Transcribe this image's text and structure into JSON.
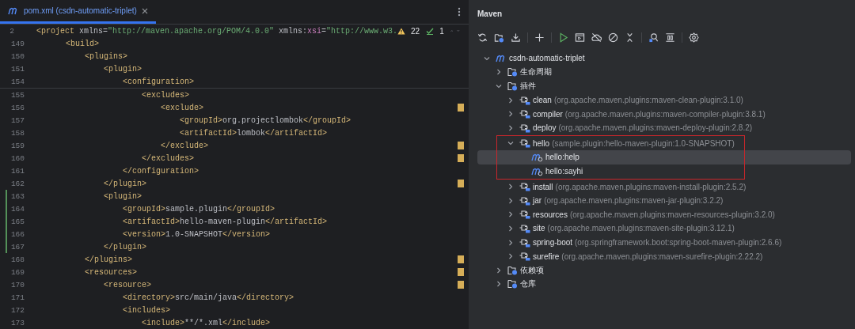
{
  "editor": {
    "tab": {
      "label": "pom.xml (csdn-automatic-triplet)",
      "selected": true
    },
    "inspections": {
      "warnings": "22",
      "checks": "1"
    },
    "sticky_lines": [
      {
        "number": "2",
        "segments": [
          {
            "kind": "tag",
            "text": "<project"
          },
          {
            "kind": "attr",
            "text": " xmlns="
          },
          {
            "kind": "value",
            "text": "\"http://maven.apache.org/POM/4.0.0\""
          },
          {
            "kind": "attr",
            "text": " xmlns:"
          },
          {
            "kind": "ns",
            "text": "xsi"
          },
          {
            "kind": "attr",
            "text": "="
          },
          {
            "kind": "value",
            "text": "\"http://www.w3."
          }
        ]
      },
      {
        "number": "149",
        "segments": [
          {
            "kind": "tag",
            "text": "    <build>"
          }
        ]
      },
      {
        "number": "150",
        "segments": [
          {
            "kind": "tag",
            "text": "        <plugins>"
          }
        ]
      },
      {
        "number": "151",
        "segments": [
          {
            "kind": "tag",
            "text": "            <plugin>"
          }
        ]
      },
      {
        "number": "154",
        "segments": [
          {
            "kind": "tag",
            "text": "                <configuration>"
          }
        ]
      }
    ],
    "lines": [
      {
        "number": "155",
        "changed": false,
        "marker": false,
        "segments": [
          {
            "kind": "tag",
            "text": "                    <excludes>"
          }
        ]
      },
      {
        "number": "156",
        "changed": false,
        "marker": true,
        "segments": [
          {
            "kind": "tag",
            "text": "                        <exclude>"
          }
        ]
      },
      {
        "number": "157",
        "changed": false,
        "marker": false,
        "segments": [
          {
            "kind": "tag",
            "text": "                            <groupId>"
          },
          {
            "kind": "text",
            "text": "org.projectlombok"
          },
          {
            "kind": "tag",
            "text": "</groupId>"
          }
        ]
      },
      {
        "number": "158",
        "changed": false,
        "marker": false,
        "segments": [
          {
            "kind": "tag",
            "text": "                            <artifactId>"
          },
          {
            "kind": "text",
            "text": "lombok"
          },
          {
            "kind": "tag",
            "text": "</artifactId>"
          }
        ]
      },
      {
        "number": "159",
        "changed": false,
        "marker": true,
        "segments": [
          {
            "kind": "tag",
            "text": "                        </exclude>"
          }
        ]
      },
      {
        "number": "160",
        "changed": false,
        "marker": true,
        "segments": [
          {
            "kind": "tag",
            "text": "                    </excludes>"
          }
        ]
      },
      {
        "number": "161",
        "changed": false,
        "marker": false,
        "segments": [
          {
            "kind": "tag",
            "text": "                </configuration>"
          }
        ]
      },
      {
        "number": "162",
        "changed": false,
        "marker": true,
        "segments": [
          {
            "kind": "tag",
            "text": "            </plugin>"
          }
        ]
      },
      {
        "number": "163",
        "changed": true,
        "marker": false,
        "segments": [
          {
            "kind": "tag",
            "text": "            <plugin>"
          }
        ]
      },
      {
        "number": "164",
        "changed": true,
        "marker": false,
        "segments": [
          {
            "kind": "tag",
            "text": "                <groupId>"
          },
          {
            "kind": "text",
            "text": "sample.plugin"
          },
          {
            "kind": "tag",
            "text": "</groupId>"
          }
        ]
      },
      {
        "number": "165",
        "changed": true,
        "marker": false,
        "segments": [
          {
            "kind": "tag",
            "text": "                <artifactId>"
          },
          {
            "kind": "text",
            "text": "hello-maven-plugin"
          },
          {
            "kind": "tag",
            "text": "</artifactId>"
          }
        ]
      },
      {
        "number": "166",
        "changed": true,
        "marker": false,
        "segments": [
          {
            "kind": "tag",
            "text": "                <version>"
          },
          {
            "kind": "text",
            "text": "1.0-SNAPSHOT"
          },
          {
            "kind": "tag",
            "text": "</version>"
          }
        ]
      },
      {
        "number": "167",
        "changed": true,
        "marker": false,
        "segments": [
          {
            "kind": "tag",
            "text": "            </plugin>"
          }
        ]
      },
      {
        "number": "168",
        "changed": false,
        "marker": true,
        "segments": [
          {
            "kind": "tag",
            "text": "        </plugins>"
          }
        ]
      },
      {
        "number": "169",
        "changed": false,
        "marker": true,
        "segments": [
          {
            "kind": "tag",
            "text": "        <resources>"
          }
        ]
      },
      {
        "number": "170",
        "changed": false,
        "marker": true,
        "segments": [
          {
            "kind": "tag",
            "text": "            <resource>"
          }
        ]
      },
      {
        "number": "171",
        "changed": false,
        "marker": false,
        "segments": [
          {
            "kind": "tag",
            "text": "                <directory>"
          },
          {
            "kind": "text",
            "text": "src/main/java"
          },
          {
            "kind": "tag",
            "text": "</directory>"
          }
        ]
      },
      {
        "number": "172",
        "changed": false,
        "marker": false,
        "segments": [
          {
            "kind": "tag",
            "text": "                <includes>"
          }
        ]
      },
      {
        "number": "173",
        "changed": false,
        "marker": false,
        "segments": [
          {
            "kind": "tag",
            "text": "                    <include>"
          },
          {
            "kind": "text",
            "text": "**/*.xml"
          },
          {
            "kind": "tag",
            "text": "</include>"
          }
        ]
      }
    ]
  },
  "maven": {
    "title": "Maven",
    "tree": {
      "kind": "project",
      "label": "csdn-automatic-triplet",
      "expanded": true,
      "selected": false,
      "children": [
        {
          "kind": "folder",
          "label": "生命周期",
          "expanded": false,
          "selected": false
        },
        {
          "kind": "folder",
          "label": "插件",
          "expanded": true,
          "selected": false,
          "children": [
            {
              "kind": "plugin",
              "label": "clean",
              "detail": "(org.apache.maven.plugins:maven-clean-plugin:3.1.0)",
              "expanded": false,
              "selected": false
            },
            {
              "kind": "plugin",
              "label": "compiler",
              "detail": "(org.apache.maven.plugins:maven-compiler-plugin:3.8.1)",
              "expanded": false,
              "selected": false
            },
            {
              "kind": "plugin",
              "label": "deploy",
              "detail": "(org.apache.maven.plugins:maven-deploy-plugin:2.8.2)",
              "expanded": false,
              "selected": false
            },
            {
              "kind": "plugin",
              "label": "hello",
              "detail": "(sample.plugin:hello-maven-plugin:1.0-SNAPSHOT)",
              "expanded": true,
              "selected": false,
              "framed": true,
              "children": [
                {
                  "kind": "goal",
                  "label": "hello:help",
                  "selected": true
                },
                {
                  "kind": "goal",
                  "label": "hello:sayhi",
                  "selected": false
                }
              ]
            },
            {
              "kind": "plugin",
              "label": "install",
              "detail": "(org.apache.maven.plugins:maven-install-plugin:2.5.2)",
              "expanded": false,
              "selected": false
            },
            {
              "kind": "plugin",
              "label": "jar",
              "detail": "(org.apache.maven.plugins:maven-jar-plugin:3.2.2)",
              "expanded": false,
              "selected": false
            },
            {
              "kind": "plugin",
              "label": "resources",
              "detail": "(org.apache.maven.plugins:maven-resources-plugin:3.2.0)",
              "expanded": false,
              "selected": false
            },
            {
              "kind": "plugin",
              "label": "site",
              "detail": "(org.apache.maven.plugins:maven-site-plugin:3.12.1)",
              "expanded": false,
              "selected": false
            },
            {
              "kind": "plugin",
              "label": "spring-boot",
              "detail": "(org.springframework.boot:spring-boot-maven-plugin:2.6.6)",
              "expanded": false,
              "selected": false
            },
            {
              "kind": "plugin",
              "label": "surefire",
              "detail": "(org.apache.maven.plugins:maven-surefire-plugin:2.22.2)",
              "expanded": false,
              "selected": false
            }
          ]
        },
        {
          "kind": "folder",
          "label": "依赖项",
          "expanded": false,
          "selected": false
        },
        {
          "kind": "folder",
          "label": "仓库",
          "expanded": false,
          "selected": false
        }
      ]
    }
  }
}
